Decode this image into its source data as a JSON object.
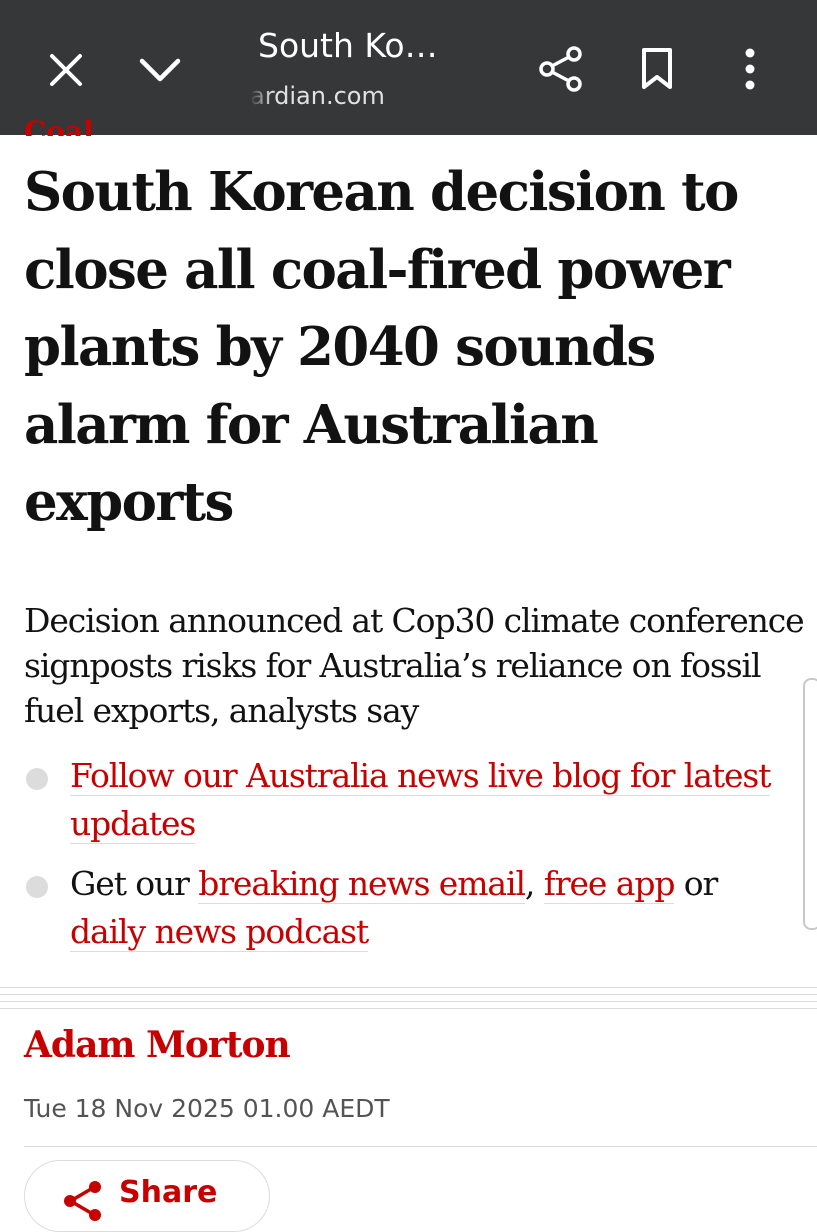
{
  "browser": {
    "page_title": "South Ko…",
    "url": "ardian.com"
  },
  "article": {
    "section": "Coal",
    "headline": "South Korean decision to close all coal-fired power plants by 2040 sounds alarm for Australian exports",
    "standfirst": "Decision announced at Cop30 climate conference signposts risks for Australia’s reliance on fossil fuel exports, analysts say",
    "bullet1_link": "Follow our Australia news live blog for latest updates",
    "bullet2_text1": "Get our ",
    "bullet2_link1": "breaking news email",
    "bullet2_sep": ", ",
    "bullet2_link2": "free app",
    "bullet2_text2": " or ",
    "bullet2_link3": "daily news podcast",
    "author": "Adam Morton",
    "date": "Tue 18 Nov 2025 01.00 AEDT",
    "share_label": "Share"
  },
  "colors": {
    "toolbar_bg": "#353738",
    "accent_red": "#c70000",
    "text": "#121212"
  }
}
